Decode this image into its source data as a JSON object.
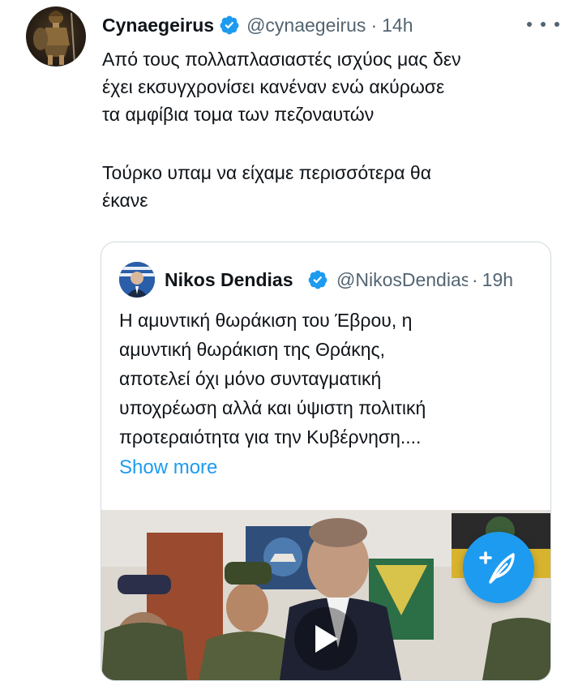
{
  "tweet": {
    "author_name": "Cynaegeirus",
    "handle": "@cynaegeirus",
    "separator": "·",
    "time": "14h",
    "text_lines": [
      "Από τους πολλαπλασιαστές ισχύος μας δεν",
      "έχει εκσυγχρονίσει κανέναν ενώ ακύρωσε",
      "τα αμφίβια τομα των πεζοναυτών",
      "",
      "Τούρκο υπαμ να είχαμε περισσότερα θα",
      "έκανε"
    ]
  },
  "quoted_tweet": {
    "author_name": "Nikos Dendias",
    "handle": "@NikosDendias",
    "separator": "·",
    "time": "19h",
    "text_lines": [
      "Η αμυντική θωράκιση του Έβρου, η",
      "αμυντική θωράκιση της Θράκης,",
      "αποτελεί όχι μόνο συνταγματική",
      "υποχρέωση αλλά και ύψιστη πολιτική",
      "προτεραιότητα για την Κυβέρνηση...."
    ],
    "show_more_label": "Show more"
  },
  "icons": {
    "verified": "verified-badge-icon",
    "more": "more-icon",
    "compose": "compose-tweet-icon",
    "play": "play-icon"
  },
  "colors": {
    "accent": "#1d9bf0",
    "text_primary": "#0f1419",
    "text_secondary": "#536471",
    "border": "#cfd9de"
  }
}
